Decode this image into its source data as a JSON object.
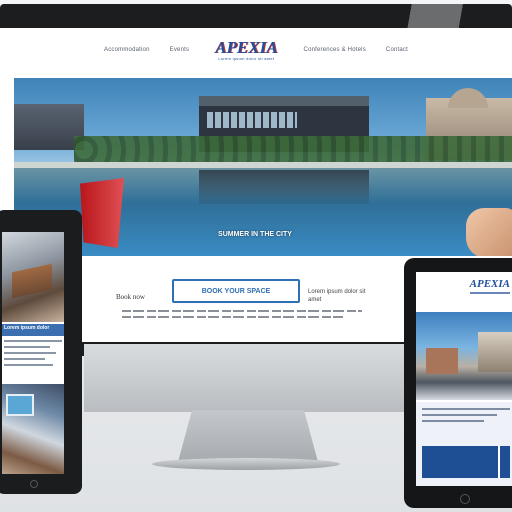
{
  "nav": {
    "links": [
      "Accommodation",
      "Events",
      "Conferences & Hotels",
      "Contact"
    ]
  },
  "logo": {
    "word": "APEXIA",
    "tagline": "Lorem ipsum dolor sit amet"
  },
  "hero": {
    "caption": "SUMMER IN THE CITY"
  },
  "content": {
    "intro_label": "Book now",
    "cta_label": "BOOK YOUR SPACE",
    "side_note": "Lorem ipsum dolor sit amet"
  },
  "tablet_left": {
    "bar_text": "Lorem ipsum dolor"
  },
  "tablet_right": {
    "logo": "APEXIA"
  },
  "colors": {
    "brand": "#1f4f9a",
    "accent": "#2f6fb3",
    "device_frame": "#1b1c1e"
  }
}
